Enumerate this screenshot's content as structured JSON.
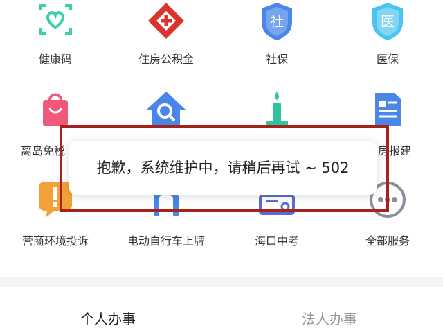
{
  "services": {
    "row1": [
      {
        "label": "健康码",
        "icon": "health-code-icon",
        "symbol": ""
      },
      {
        "label": "住房公积金",
        "icon": "housing-fund-icon",
        "symbol": ""
      },
      {
        "label": "社保",
        "icon": "social-security-icon",
        "symbol": "社"
      },
      {
        "label": "医保",
        "icon": "medical-insurance-icon",
        "symbol": "医"
      }
    ],
    "row2": [
      {
        "label": "离岛免税",
        "icon": "duty-free-icon"
      },
      {
        "label": "",
        "icon": "house-search-icon"
      },
      {
        "label": "",
        "icon": "candle-icon"
      },
      {
        "label": "房报建",
        "icon": "document-icon"
      }
    ],
    "row3": [
      {
        "label": "营商环境投诉",
        "icon": "complaint-icon"
      },
      {
        "label": "电动自行车上牌",
        "icon": "ebike-plate-icon"
      },
      {
        "label": "海口中考",
        "icon": "exam-icon"
      },
      {
        "label": "全部服务",
        "icon": "more-icon"
      }
    ]
  },
  "toast": {
    "message": "抱歉，系统维护中，请稍后再试 ~ 502"
  },
  "tabs": [
    {
      "label": "个人办事",
      "active": true
    },
    {
      "label": "法人办事",
      "active": false
    }
  ],
  "colors": {
    "teal": "#3ecfa8",
    "red": "#d9352c",
    "blue": "#4a86e8",
    "pink": "#f0597a",
    "green": "#2fc3a0",
    "orange": "#f3a23a",
    "gray": "#8a8f99",
    "highlight_border": "#a5231d"
  }
}
